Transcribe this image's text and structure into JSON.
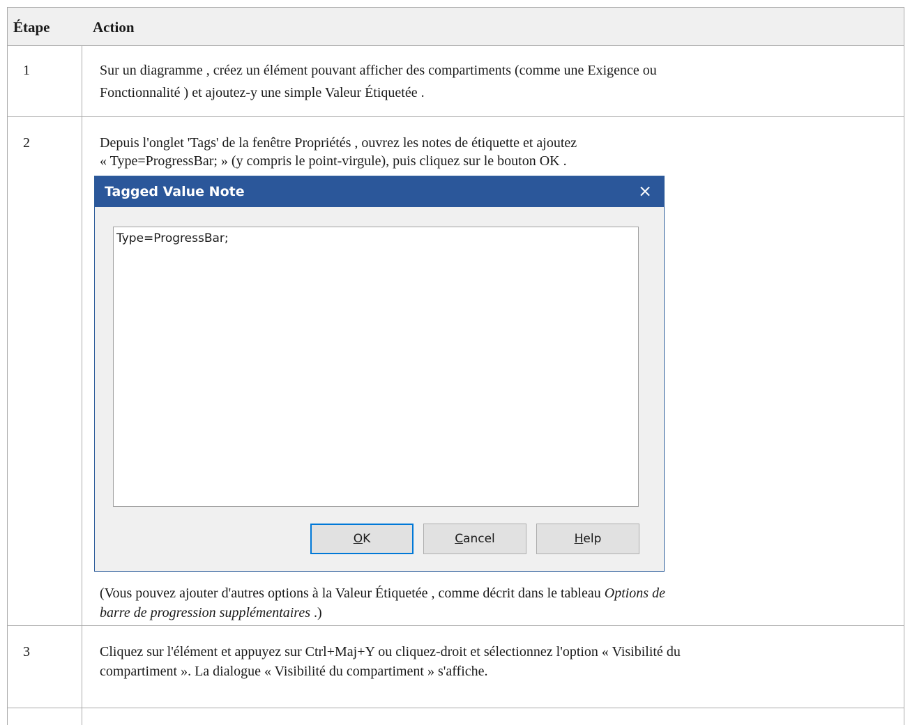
{
  "table": {
    "header": {
      "step": "Étape",
      "action": "Action"
    },
    "rows": [
      {
        "step": "1",
        "lines": [
          "Sur un diagramme , créez un élément pouvant afficher des compartiments (comme une Exigence ou",
          "Fonctionnalité ) et ajoutez-y une simple Valeur Étiquetée ."
        ]
      },
      {
        "step": "2",
        "lines": [
          "Depuis l'onglet 'Tags' de la fenêtre Propriétés , ouvrez les notes de étiquette et ajoutez",
          "« Type=ProgressBar; » (y compris le point-virgule), puis cliquez sur le bouton OK ."
        ],
        "note_line1_a": "(Vous pouvez ajouter d'autres options à la Valeur Étiquetée , comme décrit dans le tableau ",
        "note_line1_italic": "Options de",
        "note_line2_italic": "barre de progression supplémentaires",
        "note_line2_b": " .)"
      },
      {
        "step": "3",
        "lines": [
          "Cliquez sur l'élément et appuyez sur Ctrl+Maj+Y ou cliquez-droit et sélectionnez l'option « Visibilité du",
          "compartiment ». La dialogue « Visibilité du compartiment » s'affiche."
        ]
      }
    ]
  },
  "dialog": {
    "title": "Tagged Value Note",
    "close_icon": "×",
    "text_value": "Type=ProgressBar;",
    "buttons": {
      "ok": {
        "mnemonic": "O",
        "rest": "K"
      },
      "cancel": {
        "mnemonic": "C",
        "rest": "ancel"
      },
      "help": {
        "mnemonic": "H",
        "rest": "elp"
      }
    },
    "colors": {
      "titlebar": "#2b579a",
      "body": "#f0f0f0",
      "accent": "#0078d7"
    }
  }
}
